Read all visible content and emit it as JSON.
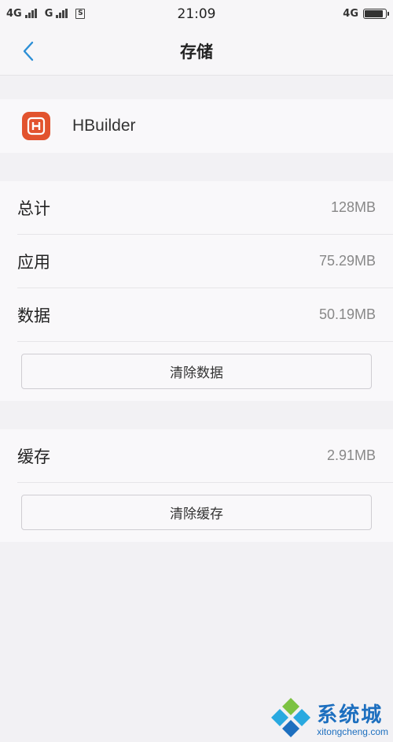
{
  "status_bar": {
    "sim1": "4G",
    "sim2": "G",
    "sim_badge": "S",
    "time": "21:09",
    "network": "4G",
    "battery_level": 0.9
  },
  "nav": {
    "title": "存储"
  },
  "app": {
    "name": "HBuilder",
    "icon_letter": "H",
    "icon_color": "#e2532e"
  },
  "storage": {
    "rows": [
      {
        "label": "总计",
        "value": "128MB"
      },
      {
        "label": "应用",
        "value": "75.29MB"
      },
      {
        "label": "数据",
        "value": "50.19MB"
      }
    ],
    "clear_data_label": "清除数据"
  },
  "cache": {
    "label": "缓存",
    "value": "2.91MB",
    "clear_cache_label": "清除缓存"
  },
  "watermark": {
    "cn": "系统城",
    "en": "xitongcheng.com"
  },
  "colors": {
    "accent": "#2c8fd6",
    "background": "#f2f1f4"
  }
}
